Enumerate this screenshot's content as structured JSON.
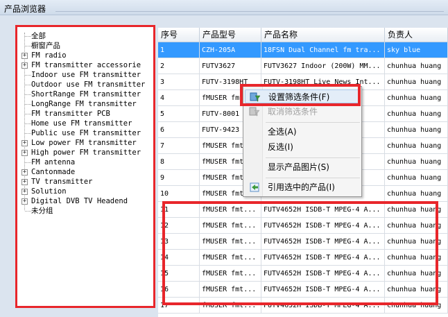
{
  "window": {
    "title": "产品浏览器"
  },
  "tree": {
    "items": [
      {
        "label": "全部",
        "expandable": false
      },
      {
        "label": "橱窗产品",
        "expandable": false
      },
      {
        "label": "FM radio",
        "expandable": true
      },
      {
        "label": "FM transmitter accessorie",
        "expandable": true
      },
      {
        "label": "Indoor use FM transmitter",
        "expandable": false
      },
      {
        "label": "Outdoor use FM transmitter",
        "expandable": false
      },
      {
        "label": "ShortRange FM transmitter",
        "expandable": false
      },
      {
        "label": "LongRange FM transmitter",
        "expandable": false
      },
      {
        "label": "FM transmitter PCB",
        "expandable": false
      },
      {
        "label": "Home use FM transmitter",
        "expandable": false
      },
      {
        "label": "Public use FM transmitter",
        "expandable": false
      },
      {
        "label": "Low power FM transmitter",
        "expandable": true
      },
      {
        "label": "High power FM transmitter",
        "expandable": true
      },
      {
        "label": "FM antenna",
        "expandable": false
      },
      {
        "label": "Cantonmade",
        "expandable": true
      },
      {
        "label": "TV transmitter",
        "expandable": true
      },
      {
        "label": "Solution",
        "expandable": true
      },
      {
        "label": "Digital DVB  TV Headend",
        "expandable": true
      },
      {
        "label": "未分组",
        "expandable": false
      }
    ]
  },
  "grid": {
    "columns": [
      "序号",
      "产品型号",
      "产品名称",
      "负责人"
    ],
    "rows": [
      [
        "1",
        "CZH-205A",
        "18FSN Dual Channel fm tra...",
        "sky blue"
      ],
      [
        "2",
        "FUTV3627",
        "FUTV3627 Indoor (200W) MM...",
        "chunhua huang"
      ],
      [
        "3",
        "FUTV-3198HT",
        "FUTV-3198HT Live News Int...",
        "chunhua huang"
      ],
      [
        "4",
        "fMUSER fmt...",
        "",
        "chunhua huang"
      ],
      [
        "5",
        "FUTV-8001",
        "",
        "chunhua huang"
      ],
      [
        "6",
        "FUTV-9423",
        "",
        "chunhua huang"
      ],
      [
        "7",
        "fMUSER fmt...",
        "",
        "chunhua huang"
      ],
      [
        "8",
        "fMUSER fmt...",
        "",
        "chunhua huang"
      ],
      [
        "9",
        "fMUSER fmt...",
        "",
        "chunhua huang"
      ],
      [
        "10",
        "fMUSER fmt...",
        "",
        "chunhua huang"
      ],
      [
        "11",
        "fMUSER fmt...",
        "FUTV4652H ISDB-T MPEG-4 A...",
        "chunhua huang"
      ],
      [
        "12",
        "fMUSER fmt...",
        "FUTV4652H ISDB-T MPEG-4 A...",
        "chunhua huang"
      ],
      [
        "13",
        "fMUSER fmt...",
        "FUTV4652H ISDB-T MPEG-4 A...",
        "chunhua huang"
      ],
      [
        "14",
        "fMUSER fmt...",
        "FUTV4652H ISDB-T MPEG-4 A...",
        "chunhua huang"
      ],
      [
        "15",
        "fMUSER fmt...",
        "FUTV4652H ISDB-T MPEG-4 A...",
        "chunhua huang"
      ],
      [
        "16",
        "fMUSER fmt...",
        "FUTV4652H ISDB-T MPEG-4 A...",
        "chunhua huang"
      ],
      [
        "17",
        "fMUSER fmt...",
        "FUTV4652H ISDB-T MPEG-4 A...",
        "chunhua huang"
      ]
    ],
    "selected_row": 0
  },
  "context_menu": {
    "items": [
      {
        "label": "设置筛选条件(F)",
        "icon": "filter-icon",
        "disabled": false,
        "highlighted": true
      },
      {
        "label": "取消筛选条件",
        "icon": "filter-clear-icon",
        "disabled": true
      },
      {
        "separator": true
      },
      {
        "label": "全选(A)",
        "disabled": false
      },
      {
        "label": "反选(I)",
        "disabled": false
      },
      {
        "separator": true
      },
      {
        "label": "显示产品图片(S)",
        "disabled": false
      },
      {
        "separator": true
      },
      {
        "label": "引用选中的产品(I)",
        "icon": "insert-icon",
        "disabled": false
      }
    ]
  },
  "colors": {
    "selection": "#3399ff",
    "highlight_box": "#e8262b",
    "menu_hover": "#e3edf8"
  }
}
